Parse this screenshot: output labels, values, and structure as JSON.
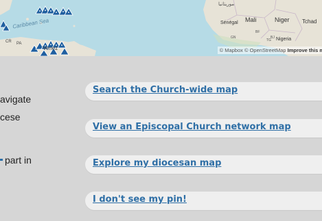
{
  "map": {
    "labels": {
      "caribbean_sea": "Caribbean Sea",
      "venezuela": "Venez",
      "mali": "Mali",
      "niger": "Niger",
      "tchad": "Tchad",
      "senegal": "Sénégal",
      "mauritanie": "موريتانيا",
      "nigeria": "Nigeria",
      "bf": "BF",
      "gn": "GN",
      "cr": "CR",
      "pa": "PA",
      "tg": "TG",
      "bj": "BJ"
    },
    "attribution": {
      "text": "© Mapbox © OpenStreetMap",
      "improve": "Improve this m"
    },
    "colors": {
      "ocean": "#b6dbe6",
      "land": "#e7e3d7",
      "pin": "#1f5fa0"
    }
  },
  "left_text": {
    "line1": "avigate",
    "line2": "cese",
    "line3": "part in"
  },
  "actions": {
    "search": "Search the Church-wide map",
    "network": "View an Episcopal Church network map",
    "diocesan": "Explore my diocesan map",
    "missing_pin": "I don't see my pin!"
  },
  "colors": {
    "background": "#d6d6d6",
    "button_bg": "#efefef",
    "link": "#2f6fa6"
  }
}
